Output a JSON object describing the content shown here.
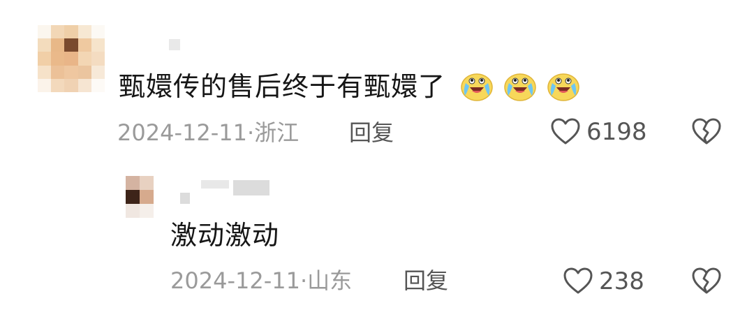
{
  "colors": {
    "background": "#ffffff",
    "text": "#161616",
    "meta": "#9a9a9a",
    "action": "#555555"
  },
  "comments": [
    {
      "avatar": "pixelated-avatar",
      "text": "甄嬛传的售后终于有甄嬛了",
      "emojis": [
        "crying-laughing-emoji",
        "crying-laughing-emoji",
        "crying-laughing-emoji"
      ],
      "date": "2024-12-11",
      "separator": "·",
      "location": "浙江",
      "reply_label": "回复",
      "like_icon": "heart-outline-icon",
      "likes": "6198",
      "dislike_icon": "broken-heart-icon"
    },
    {
      "avatar": "pixelated-avatar",
      "text": "激动激动",
      "date": "2024-12-11",
      "separator": "·",
      "location": "山东",
      "reply_label": "回复",
      "like_icon": "heart-outline-icon",
      "likes": "238",
      "dislike_icon": "broken-heart-icon"
    }
  ]
}
